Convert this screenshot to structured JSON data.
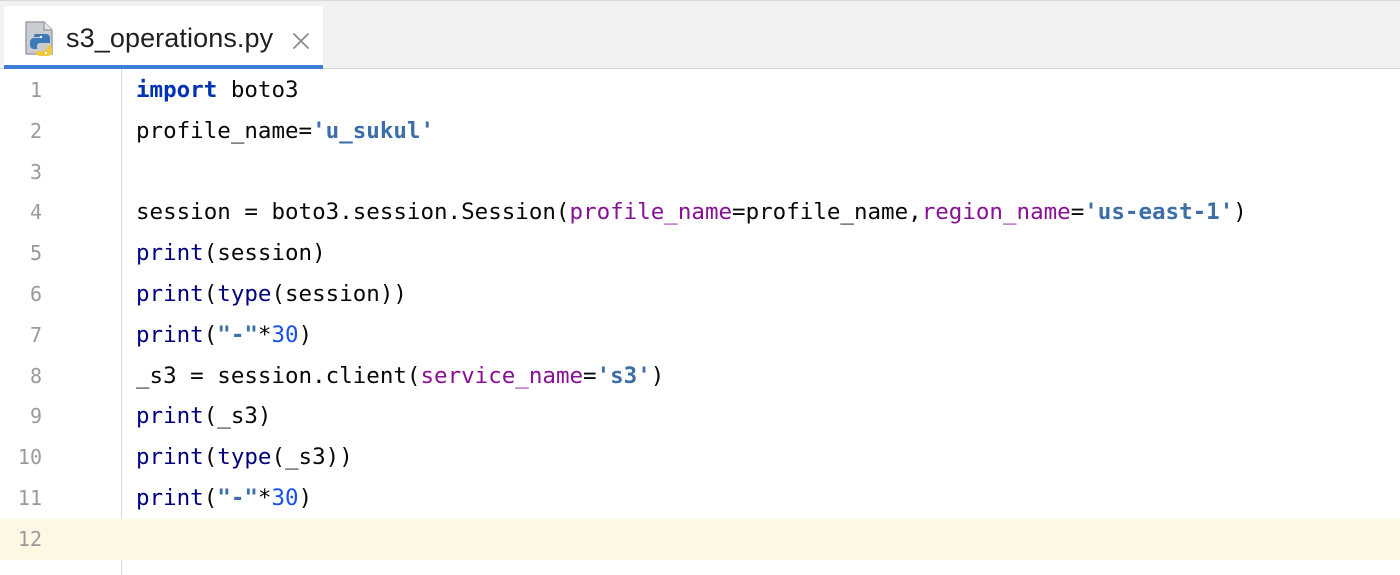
{
  "tab": {
    "filename": "s3_operations.py",
    "file_icon": "python-file-icon",
    "close_icon": "close-icon",
    "accent": "#3b7ed8"
  },
  "editor": {
    "current_line": 12,
    "current_line_color": "#fdf8e4",
    "lines": [
      {
        "n": "1",
        "tokens": [
          {
            "t": "import",
            "c": "kw"
          },
          {
            "t": " boto3",
            "c": "plain"
          }
        ]
      },
      {
        "n": "2",
        "tokens": [
          {
            "t": "profile_name=",
            "c": "plain"
          },
          {
            "t": "'u_sukul'",
            "c": "str2"
          }
        ]
      },
      {
        "n": "3",
        "tokens": []
      },
      {
        "n": "4",
        "tokens": [
          {
            "t": "session = boto3.session.Session(",
            "c": "plain"
          },
          {
            "t": "profile_name",
            "c": "param"
          },
          {
            "t": "=profile_name,",
            "c": "plain"
          },
          {
            "t": "region_name",
            "c": "param"
          },
          {
            "t": "=",
            "c": "plain"
          },
          {
            "t": "'us-east-1'",
            "c": "str2"
          },
          {
            "t": ")",
            "c": "plain"
          }
        ]
      },
      {
        "n": "5",
        "tokens": [
          {
            "t": "print",
            "c": "bi"
          },
          {
            "t": "(session)",
            "c": "plain"
          }
        ]
      },
      {
        "n": "6",
        "tokens": [
          {
            "t": "print",
            "c": "bi"
          },
          {
            "t": "(",
            "c": "plain"
          },
          {
            "t": "type",
            "c": "bi"
          },
          {
            "t": "(session))",
            "c": "plain"
          }
        ]
      },
      {
        "n": "7",
        "tokens": [
          {
            "t": "print",
            "c": "bi"
          },
          {
            "t": "(",
            "c": "plain"
          },
          {
            "t": "\"-\"",
            "c": "str2"
          },
          {
            "t": "*",
            "c": "plain"
          },
          {
            "t": "30",
            "c": "num"
          },
          {
            "t": ")",
            "c": "plain"
          }
        ]
      },
      {
        "n": "8",
        "tokens": [
          {
            "t": "_s3 = session.client(",
            "c": "plain"
          },
          {
            "t": "service_name",
            "c": "param"
          },
          {
            "t": "=",
            "c": "plain"
          },
          {
            "t": "'s3'",
            "c": "str2"
          },
          {
            "t": ")",
            "c": "plain"
          }
        ]
      },
      {
        "n": "9",
        "tokens": [
          {
            "t": "print",
            "c": "bi"
          },
          {
            "t": "(_s3)",
            "c": "plain"
          }
        ]
      },
      {
        "n": "10",
        "tokens": [
          {
            "t": "print",
            "c": "bi"
          },
          {
            "t": "(",
            "c": "plain"
          },
          {
            "t": "type",
            "c": "bi"
          },
          {
            "t": "(_s3))",
            "c": "plain"
          }
        ]
      },
      {
        "n": "11",
        "tokens": [
          {
            "t": "print",
            "c": "bi"
          },
          {
            "t": "(",
            "c": "plain"
          },
          {
            "t": "\"-\"",
            "c": "str2"
          },
          {
            "t": "*",
            "c": "plain"
          },
          {
            "t": "30",
            "c": "num"
          },
          {
            "t": ")",
            "c": "plain"
          }
        ]
      },
      {
        "n": "12",
        "tokens": []
      }
    ]
  }
}
